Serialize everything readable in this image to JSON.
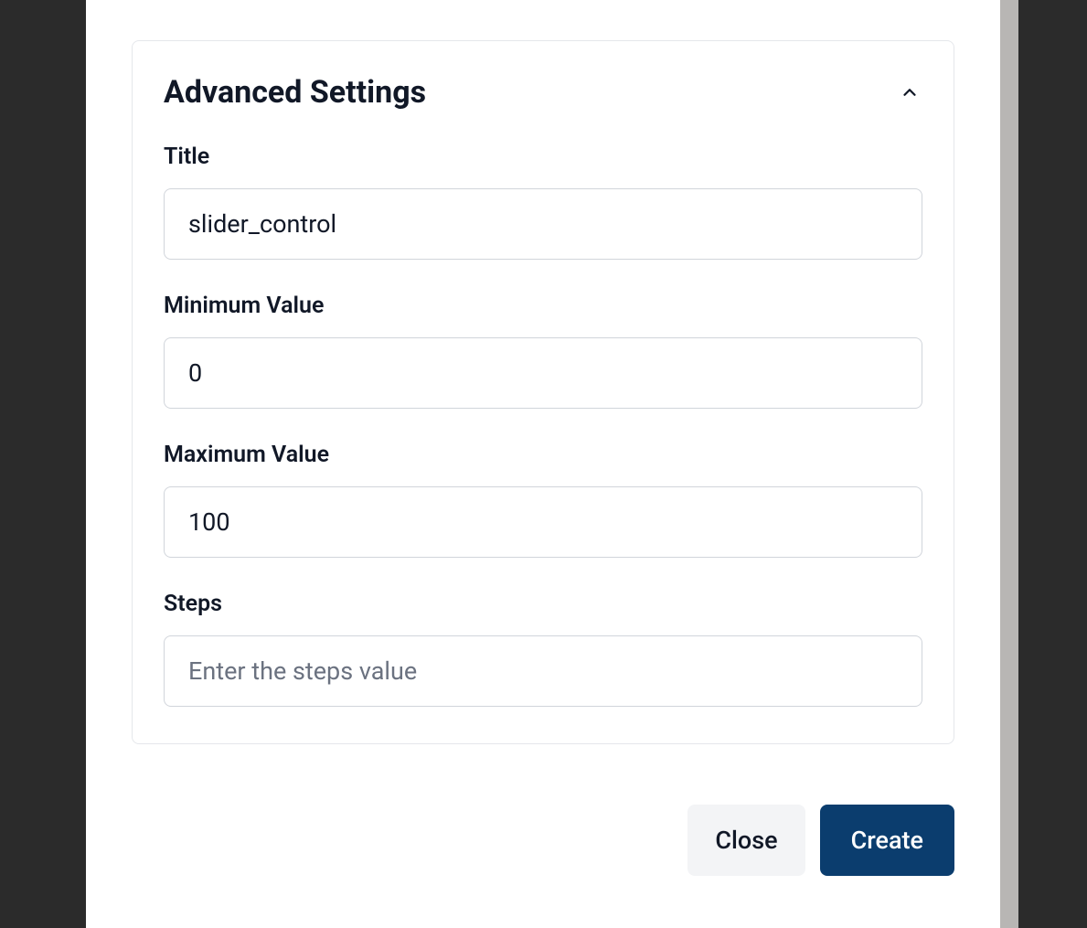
{
  "card": {
    "title": "Advanced Settings"
  },
  "fields": {
    "title": {
      "label": "Title",
      "value": "slider_control"
    },
    "min": {
      "label": "Minimum Value",
      "value": "0"
    },
    "max": {
      "label": "Maximum Value",
      "value": "100"
    },
    "steps": {
      "label": "Steps",
      "value": "",
      "placeholder": "Enter the steps value"
    }
  },
  "buttons": {
    "close": "Close",
    "create": "Create"
  }
}
